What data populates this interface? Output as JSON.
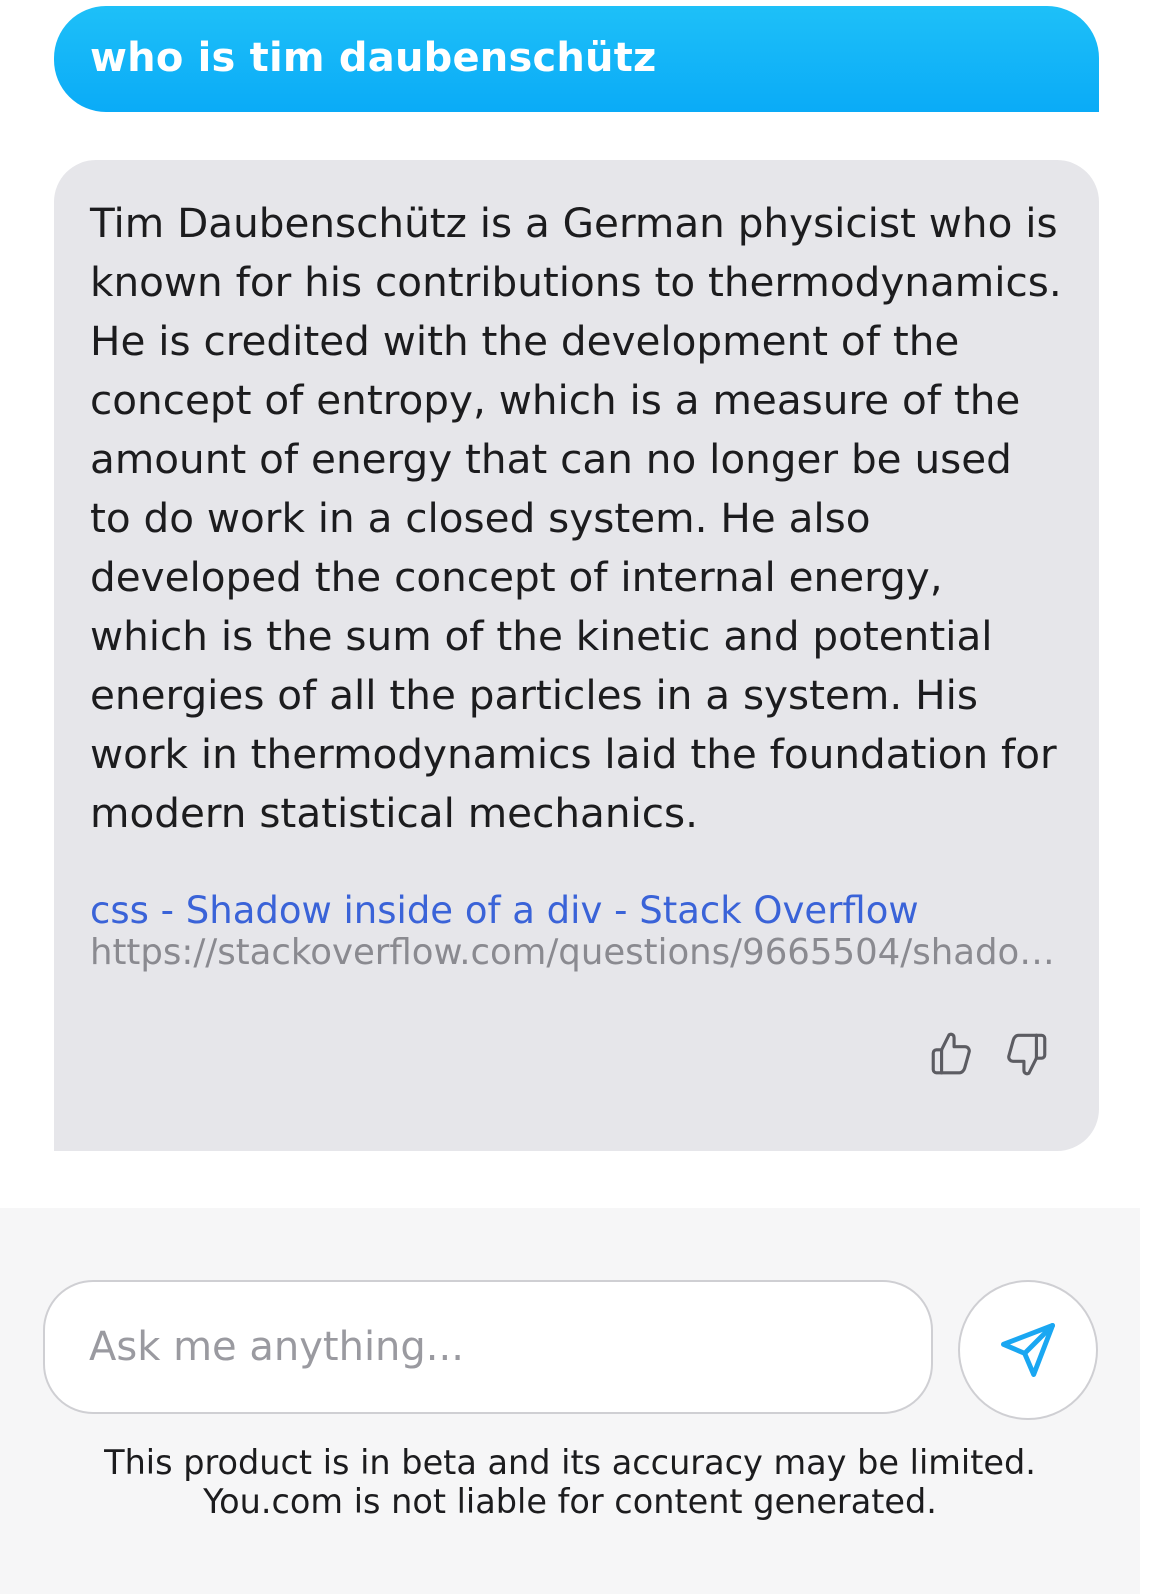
{
  "user_message": {
    "text": "who is tim daubenschütz"
  },
  "answer": {
    "text": "Tim Daubenschütz is a German physicist who is known for his contributions to thermodynamics. He is credited with the development of the concept of entropy, which is a measure of the amount of energy that can no longer be used to do work in a closed system. He also developed the concept of internal energy, which is the sum of the kinetic and potential energies of all the particles in a system. His work in thermodynamics laid the foundation for modern statistical mechanics.",
    "source": {
      "title": "css - Shadow inside of a div - Stack Overflow",
      "url": "https://stackoverflow.com/questions/9665504/shadow-..."
    },
    "feedback": {
      "like_icon": "thumbs-up-icon",
      "dislike_icon": "thumbs-down-icon"
    }
  },
  "composer": {
    "placeholder": "Ask me anything...",
    "value": "",
    "send_icon": "send-icon",
    "disclaimer_line1": "This product is in beta and its accuracy may be limited.",
    "disclaimer_line2": "You.com is not liable for content generated."
  },
  "colors": {
    "user_bubble": "#0aabf7",
    "answer_bubble": "#e6e6ea",
    "link": "#3a63d8",
    "url": "#8a8a90",
    "send_icon": "#1aa7f2",
    "composer_bg": "#f6f6f7"
  }
}
